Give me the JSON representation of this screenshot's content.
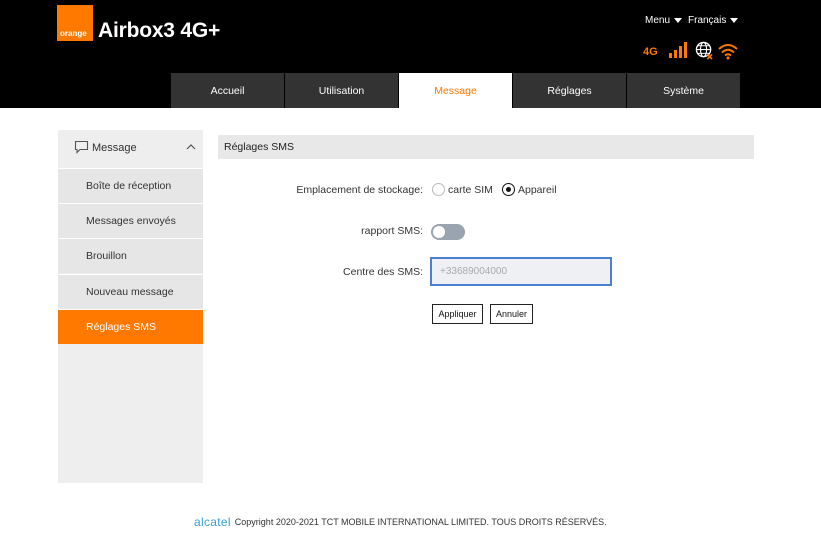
{
  "header": {
    "brand_logo_text": "orange",
    "product_title": "Airbox3 4G+",
    "menu_label": "Menu",
    "language_label": "Français",
    "network_type": "4G",
    "colors": {
      "accent": "#ff7900",
      "header_bg": "#000000",
      "tab_bg": "#333333"
    }
  },
  "tabs": [
    {
      "label": "Accueil"
    },
    {
      "label": "Utilisation"
    },
    {
      "label": "Message",
      "active": true
    },
    {
      "label": "Réglages"
    },
    {
      "label": "Système"
    }
  ],
  "sidebar": {
    "section_icon": "chat-bubble-icon",
    "section_label": "Message",
    "items": [
      {
        "label": "Boîte de réception"
      },
      {
        "label": "Messages envoyés"
      },
      {
        "label": "Brouillon"
      },
      {
        "label": "Nouveau message"
      },
      {
        "label": "Réglages SMS",
        "active": true
      }
    ]
  },
  "panel": {
    "title": "Réglages SMS",
    "storage": {
      "label": "Emplacement de stockage:",
      "option_sim": "carte SIM",
      "option_device": "Appareil",
      "selected": "Appareil"
    },
    "report": {
      "label": "rapport SMS:",
      "enabled": false
    },
    "center": {
      "label": "Centre des SMS:",
      "value": "",
      "placeholder": "+33689004000"
    },
    "apply_label": "Appliquer",
    "cancel_label": "Annuler"
  },
  "footer": {
    "brand": "alcatel",
    "copyright": "Copyright 2020-2021 TCT MOBILE INTERNATIONAL LIMITED. TOUS DROITS RÉSERVÉS."
  }
}
